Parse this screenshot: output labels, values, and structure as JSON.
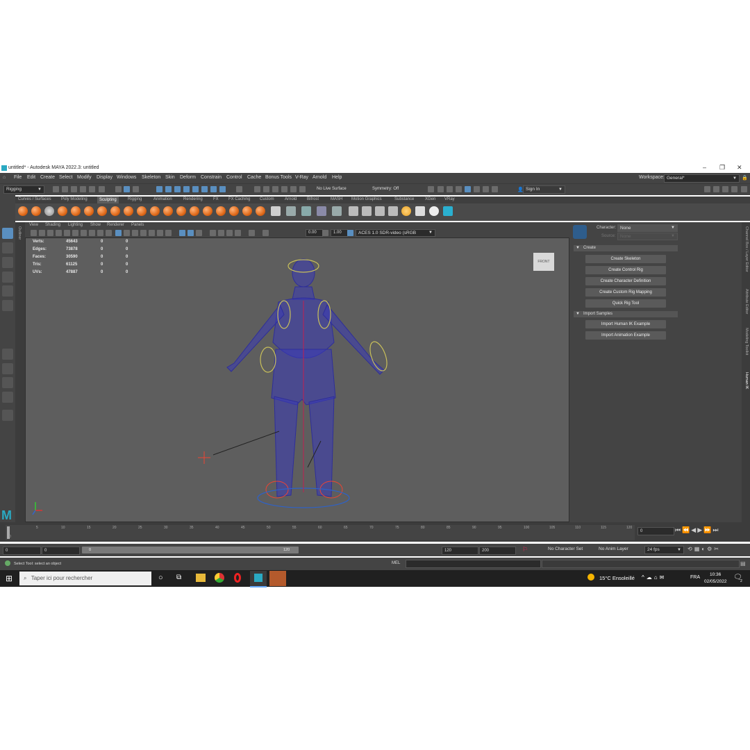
{
  "window": {
    "title": "untitled* - Autodesk MAYA 2022.3: untitled",
    "controls": [
      "–",
      "❐",
      "✕"
    ]
  },
  "menus": [
    "File",
    "Edit",
    "Create",
    "Select",
    "Modify",
    "Display",
    "Windows",
    "Skeleton",
    "Skin",
    "Deform",
    "Constrain",
    "Control",
    "Cache",
    "Bonus Tools",
    "V-Ray",
    "Arnold",
    "Help"
  ],
  "workspace": {
    "label": "Workspace:",
    "value": "General*"
  },
  "statusline": {
    "mode": "Rigging",
    "live_surface": "No Live Surface",
    "symmetry": "Symmetry: Off",
    "sign_in": "Sign In"
  },
  "shelf_tabs": [
    "Curves / Surfaces",
    "Poly Modeling",
    "Sculpting",
    "Rigging",
    "Animation",
    "Rendering",
    "FX",
    "FX Caching",
    "Custom",
    "Arnold",
    "Bifrost",
    "MASH",
    "Motion Graphics",
    "Substance",
    "XGen",
    "VRay"
  ],
  "shelf_active": "Sculpting",
  "viewport_menu": [
    "View",
    "Shading",
    "Lighting",
    "Show",
    "Renderer",
    "Panels"
  ],
  "viewport_tools": {
    "exposure": "0.00",
    "gamma": "1.00",
    "colorspace": "ACES 1.0 SDR-video (sRGB"
  },
  "hud": {
    "labels": [
      "Verts:",
      "Edges:",
      "Faces:",
      "Tris:",
      "UVs:"
    ],
    "totals": [
      "45643",
      "73878",
      "30590",
      "61125",
      "47887"
    ],
    "col2": [
      "0",
      "0",
      "0",
      "0",
      "0"
    ],
    "col3": [
      "0",
      "0",
      "0",
      "0",
      "0"
    ]
  },
  "viewcube_label": "FRONT",
  "outliner_label": "Outliner",
  "humanik": {
    "character_label": "Character:",
    "character_value": "None",
    "source_label": "Source:",
    "source_value": "None",
    "create_header": "Create",
    "create_buttons": [
      "Create Skeleton",
      "Create Control Rig",
      "Create Character Definition",
      "Create Custom Rig Mapping",
      "Quick Rig Tool"
    ],
    "samples_header": "Import Samples",
    "samples_buttons": [
      "Import Human IK Example",
      "Import Animation Example"
    ]
  },
  "right_tabs": [
    "Channel Box / Layer Editor",
    "Attribute Editor",
    "Modeling Toolkit",
    "Human IK"
  ],
  "timeline": {
    "ticks": [
      "0",
      "5",
      "10",
      "15",
      "20",
      "25",
      "30",
      "35",
      "40",
      "45",
      "50",
      "55",
      "60",
      "65",
      "70",
      "75",
      "80",
      "85",
      "90",
      "95",
      "100",
      "105",
      "110",
      "115",
      "120"
    ],
    "current_frame": "0"
  },
  "range": {
    "start": "0",
    "inner_start": "0",
    "slider_start": "0",
    "slider_end": "120",
    "end": "120",
    "anim_end": "200",
    "char_set": "No Character Set",
    "anim_layer": "No Anim Layer",
    "fps": "24 fps"
  },
  "cmdline": {
    "help_text": "Select Tool: select an object",
    "lang": "MEL"
  },
  "taskbar": {
    "search_placeholder": "Taper ici pour rechercher",
    "weather": "15°C Ensoleillé",
    "lang": "FRA",
    "time": "10:36",
    "date": "02/05/2022",
    "notif": "2"
  }
}
